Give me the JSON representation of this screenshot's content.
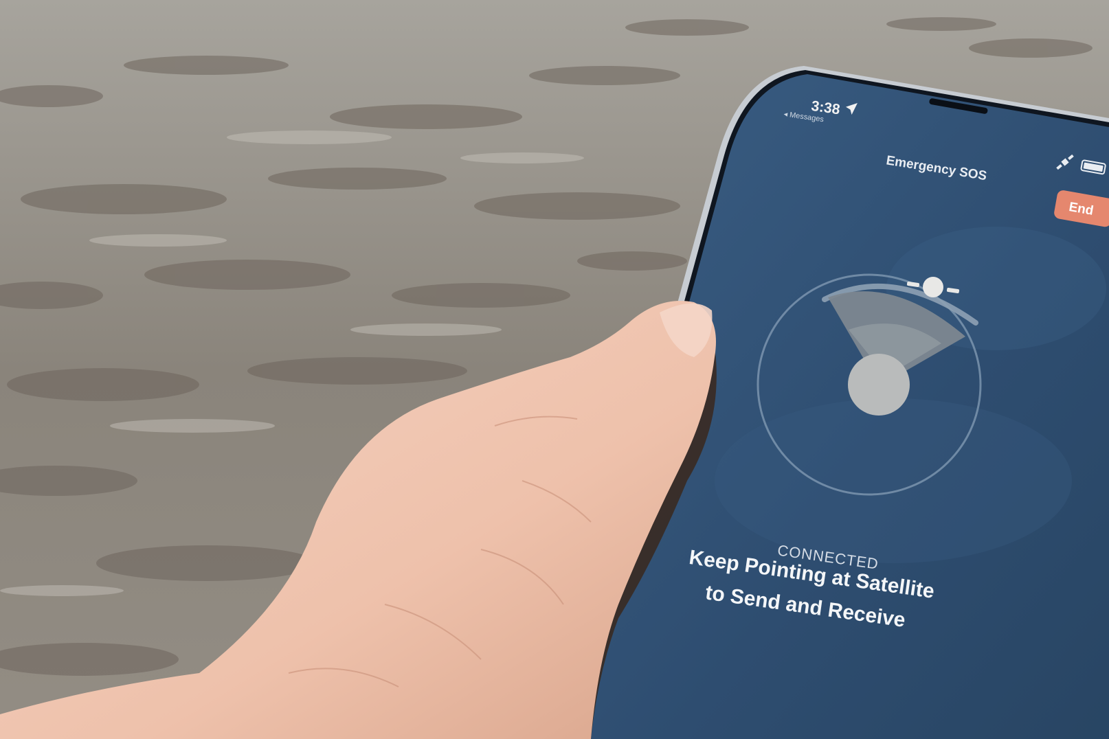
{
  "status_bar": {
    "time": "3:38",
    "back_label": "◂ Messages",
    "location_icon": "location-arrow-icon",
    "satellite_icon": "satellite-icon",
    "battery_icon": "battery-icon"
  },
  "nav": {
    "title": "Emergency SOS",
    "end_label": "End"
  },
  "main": {
    "status": "CONNECTED",
    "instruction_line1": "Keep Pointing at Satellite",
    "instruction_line2": "to Send and Receive"
  },
  "colors": {
    "screen": "#2f4e6e",
    "end_button": "#e5876e",
    "skin": "#f0c8b4",
    "ocean": "#8f8a82"
  }
}
